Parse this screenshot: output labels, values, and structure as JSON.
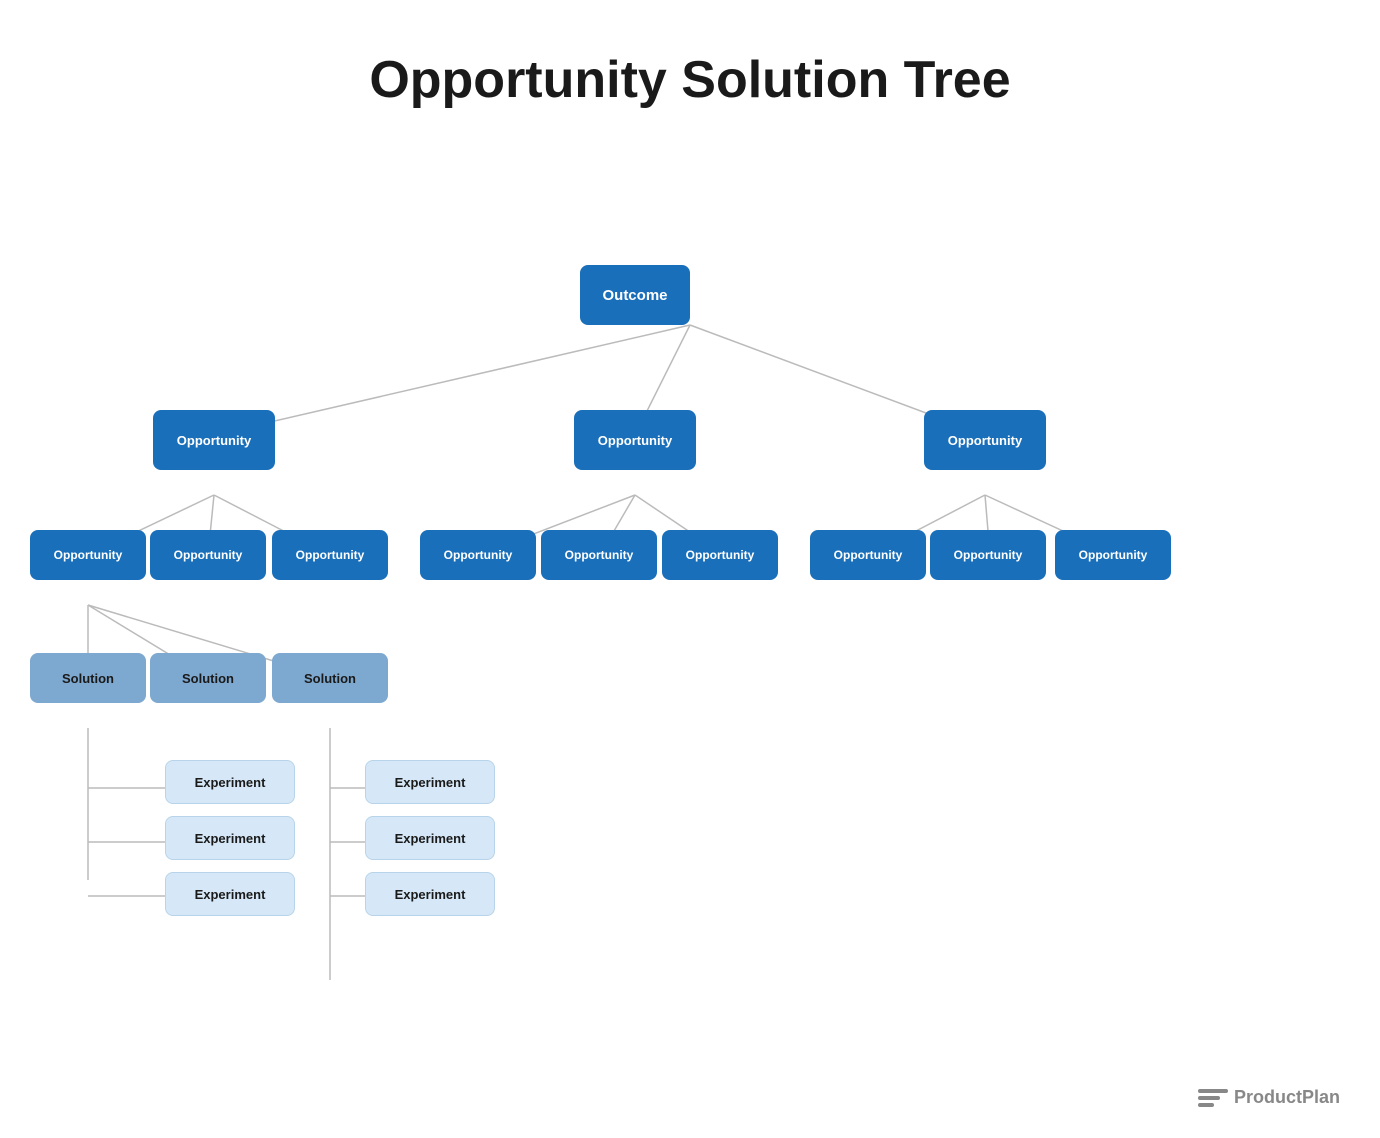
{
  "title": "Opportunity Solution Tree",
  "nodes": {
    "outcome": {
      "label": "Outcome"
    },
    "opp_mid": {
      "label": "Opportunity"
    },
    "opp_left": {
      "label": "Opportunity"
    },
    "opp_right": {
      "label": "Opportunity"
    },
    "opp_ll1": {
      "label": "Opportunity"
    },
    "opp_ll2": {
      "label": "Opportunity"
    },
    "opp_ll3": {
      "label": "Opportunity"
    },
    "opp_ml1": {
      "label": "Opportunity"
    },
    "opp_ml2": {
      "label": "Opportunity"
    },
    "opp_ml3": {
      "label": "Opportunity"
    },
    "opp_rl1": {
      "label": "Opportunity"
    },
    "opp_rl2": {
      "label": "Opportunity"
    },
    "opp_rl3": {
      "label": "Opportunity"
    },
    "sol1": {
      "label": "Solution"
    },
    "sol2": {
      "label": "Solution"
    },
    "sol3": {
      "label": "Solution"
    },
    "exp1": {
      "label": "Experiment"
    },
    "exp2": {
      "label": "Experiment"
    },
    "exp3": {
      "label": "Experiment"
    },
    "exp4": {
      "label": "Experiment"
    },
    "exp5": {
      "label": "Experiment"
    },
    "exp6": {
      "label": "Experiment"
    }
  },
  "logo": {
    "text": "ProductPlan",
    "bars": [
      {
        "width": 30
      },
      {
        "width": 24
      },
      {
        "width": 18
      }
    ]
  }
}
